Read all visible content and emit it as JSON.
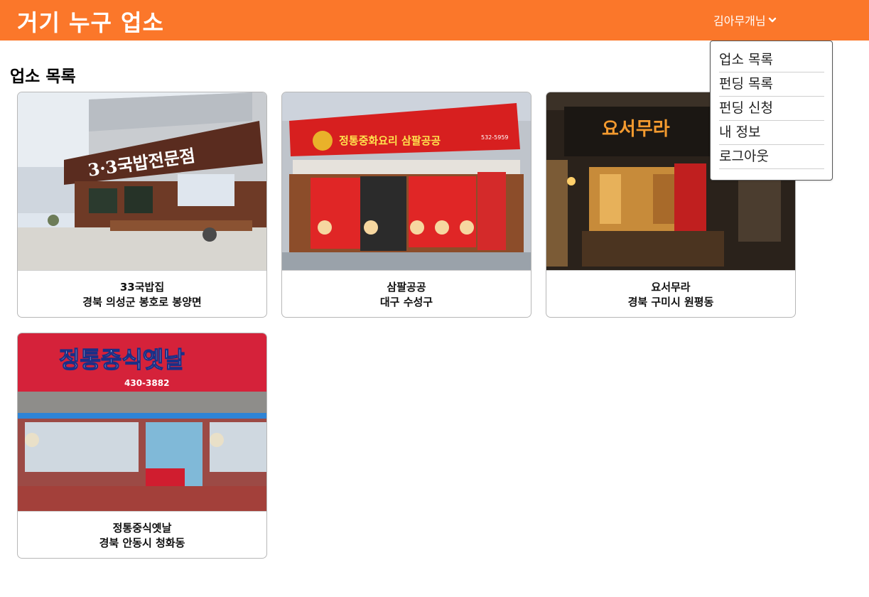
{
  "header": {
    "brand": "거기 누구 업소",
    "user_label": "김아무개님",
    "user_chevron_icon": "chevron-down-icon",
    "bar_color": "#fb772a"
  },
  "dropdown": {
    "items": [
      {
        "label": "업소 목록"
      },
      {
        "label": "펀딩 목록"
      },
      {
        "label": "펀딩 신청"
      },
      {
        "label": "내 정보"
      },
      {
        "label": "로그아웃"
      }
    ]
  },
  "main": {
    "title": "업소 목록",
    "stores": [
      {
        "name": "33국밥집",
        "address": "경북 의성군 봉호로 봉양면",
        "sign_text": "3·3국밥전문점"
      },
      {
        "name": "삼팔공공",
        "address": "대구 수성구",
        "sign_text": "정통중화요리 삼팔공공",
        "sign_phone": "532-5959"
      },
      {
        "name": "요서무라",
        "address": "경북 구미시 원평동",
        "sign_text": "요서무라"
      },
      {
        "name": "정통중식옛날",
        "address": "경북 안동시 청화동",
        "sign_text": "정통중식옛날",
        "sign_phone": "430-3882"
      }
    ]
  }
}
